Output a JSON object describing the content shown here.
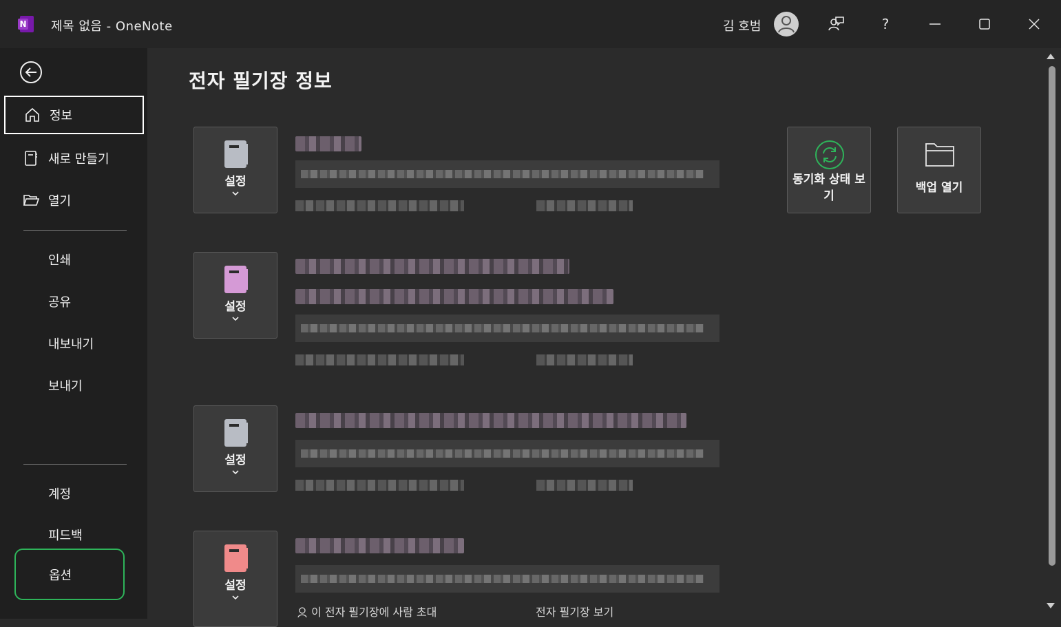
{
  "window": {
    "title": "제목 없음  -  OneNote",
    "user_name": "김 호범",
    "app_logo_letter": "N"
  },
  "sidebar": {
    "items": [
      {
        "label": "정보",
        "icon": "home-icon",
        "selected": true
      },
      {
        "label": "새로 만들기",
        "icon": "new-notebook-icon"
      },
      {
        "label": "열기",
        "icon": "folder-open-icon"
      },
      {
        "label": "인쇄"
      },
      {
        "label": "공유"
      },
      {
        "label": "내보내기"
      },
      {
        "label": "보내기"
      },
      {
        "label": "계정"
      },
      {
        "label": "피드백"
      },
      {
        "label": "옵션"
      }
    ]
  },
  "main": {
    "page_title": "전자 필기장 정보",
    "notebooks": [
      {
        "settings_label": "설정",
        "color": "#b8bcc4"
      },
      {
        "settings_label": "설정",
        "color": "#d59ad6"
      },
      {
        "settings_label": "설정",
        "color": "#b8bcc4"
      },
      {
        "settings_label": "설정",
        "color": "#f08a8a"
      }
    ],
    "actions": {
      "sync_label": "동기화 상태 보기",
      "backup_label": "백업 열기"
    },
    "bottom_links": {
      "invite": "이 전자 필기장에 사람 초대",
      "view": "전자 필기장 보기"
    }
  },
  "colors": {
    "accent_green": "#2eb45a",
    "sidebar_bg": "#1f1f1f",
    "main_bg": "#2b2b2b"
  }
}
